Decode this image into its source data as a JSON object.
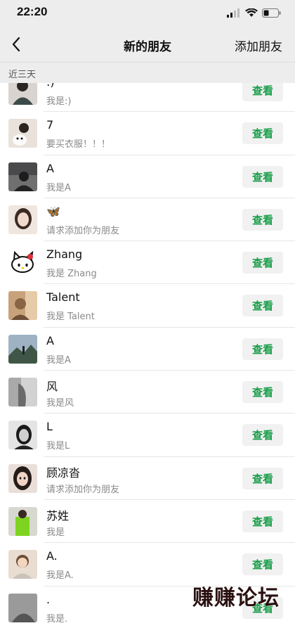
{
  "status_bar": {
    "time": "22:20"
  },
  "nav": {
    "title": "新的朋友",
    "action": "添加朋友"
  },
  "section": {
    "label": "近三天"
  },
  "button_label": "查看",
  "friends": [
    {
      "name": ":)",
      "message": "我是:)",
      "avatar": "photo-dark"
    },
    {
      "name": "7",
      "message": "要买衣服！！！",
      "avatar": "photo-dog"
    },
    {
      "name": "A",
      "message": "我是A",
      "avatar": "photo-gray"
    },
    {
      "name": "🦋",
      "message": "请求添加你为朋友",
      "avatar": "photo-girl"
    },
    {
      "name": "Zhang",
      "message": "我是 Zhang",
      "avatar": "hello-kitty"
    },
    {
      "name": "Talent",
      "message": "我是 Talent",
      "avatar": "photo-warm"
    },
    {
      "name": "A",
      "message": "我是A",
      "avatar": "photo-landscape"
    },
    {
      "name": "风",
      "message": "我是风",
      "avatar": "photo-light"
    },
    {
      "name": "L",
      "message": "我是L",
      "avatar": "photo-bw"
    },
    {
      "name": "顾凉沓",
      "message": "请求添加你为朋友",
      "avatar": "photo-portrait"
    },
    {
      "name": "苏姓",
      "message": "我是",
      "avatar": "photo-green"
    },
    {
      "name": "A.",
      "message": "我是A.",
      "avatar": "photo-boy"
    },
    {
      "name": ".",
      "message": "我是.",
      "avatar": "photo-dark2"
    }
  ],
  "watermark": "赚赚论坛",
  "colors": {
    "accent_green": "#1a9e4a",
    "bar_bg": "#ededed"
  }
}
